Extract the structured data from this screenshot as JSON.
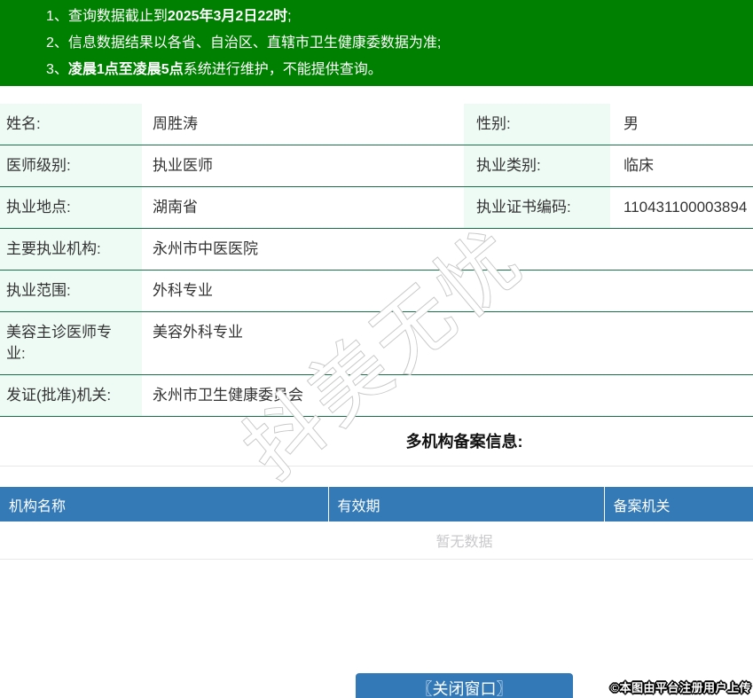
{
  "banner": {
    "bg_color": "#008000",
    "notices": [
      {
        "num": "1、",
        "pre": "查询数据截止到",
        "bold": "2025年3月2日22时",
        "post": ";"
      },
      {
        "num": "2、",
        "pre": "信息数据结果以各省、自治区、直辖市卫生健康委数据为准;",
        "bold": "",
        "post": ""
      },
      {
        "num": "3、",
        "pre": "",
        "bold": "凌晨1点至凌晨5点",
        "post": "系统进行维护，不能提供查询。"
      }
    ]
  },
  "info": {
    "label_bg_color": "#eefaf4",
    "border_color": "#1a7048",
    "rows2col": [
      {
        "l1": "姓名:",
        "v1": "周胜涛",
        "l2": "性别:",
        "v2": "男"
      },
      {
        "l1": "医师级别:",
        "v1": "执业医师",
        "l2": "执业类别:",
        "v2": "临床"
      },
      {
        "l1": "执业地点:",
        "v1": "湖南省",
        "l2": "执业证书编码:",
        "v2": "110431100003894"
      }
    ],
    "rows1col": [
      {
        "label": "主要执业机构:",
        "value": "永州市中医医院"
      },
      {
        "label": "执业范围:",
        "value": "外科专业"
      },
      {
        "label": "美容主诊医师专业:",
        "value": "美容外科专业"
      },
      {
        "label": "发证(批准)机关:",
        "value": "永州市卫生健康委员会"
      }
    ]
  },
  "records": {
    "title": "多机构备案信息:",
    "header_bg_color": "#337ab7",
    "columns": [
      "机构名称",
      "有效期",
      "备案机关"
    ],
    "rows": [],
    "empty_text": "暂无数据"
  },
  "footer": {
    "close_button_label": "〖关闭窗口〗",
    "button_color": "#3379b7",
    "credit_text": "©本图由平台注册用户上传"
  },
  "watermark": {
    "text": "抖美无忧"
  }
}
